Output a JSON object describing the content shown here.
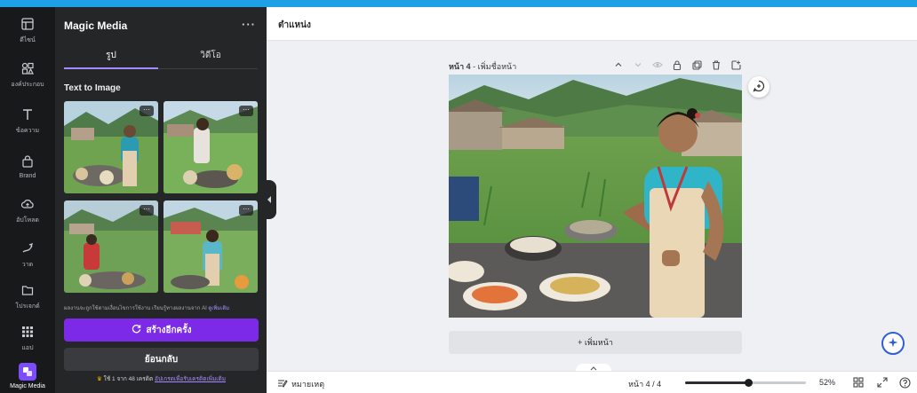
{
  "rail": {
    "items": [
      {
        "label": "ดีไซน์",
        "icon": "layout-icon"
      },
      {
        "label": "องค์ประกอบ",
        "icon": "elements-icon"
      },
      {
        "label": "ข้อความ",
        "icon": "text-icon"
      },
      {
        "label": "Brand",
        "icon": "brand-icon"
      },
      {
        "label": "อัปโหลด",
        "icon": "upload-icon"
      },
      {
        "label": "วาด",
        "icon": "draw-icon"
      },
      {
        "label": "โปรเจกต์",
        "icon": "folder-icon"
      },
      {
        "label": "แอป",
        "icon": "apps-icon"
      },
      {
        "label": "Magic Media",
        "icon": "magic-media-icon"
      }
    ]
  },
  "panel": {
    "title": "Magic Media",
    "more": "···",
    "tabs": [
      "รูป",
      "วิดีโอ"
    ],
    "section": "Text to Image",
    "thumb_more": "···",
    "disclaimer": "ผลงานจะถูกใช้ตามเงื่อนไขการใช้งาน เรียนรู้ทางผลงานจาก AI",
    "disclaimer_link": "ดูเพิ่มเติม",
    "generate_label": "สร้างอีกครั้ง",
    "back_label": "ย้อนกลับ",
    "usage_text": "ใช้ 1 จาก 48 เครดิต",
    "usage_link": "อัปเกรดเพื่อรับเครดิตเพิ่มเติม"
  },
  "topbar": {
    "position_label": "ตำแหน่ง"
  },
  "canvas": {
    "page_title_bold": "หน้า 4",
    "page_title_rest": " - เพิ่มชื่อหน้า",
    "add_page": "+ เพิ่มหน้า"
  },
  "bottombar": {
    "notes": "หมายเหตุ",
    "pager": "หน้า 4 / 4",
    "zoom_label": "52%",
    "zoom_value": 52
  },
  "colors": {
    "accent": "#7d2ae8",
    "rail": "#18191b",
    "panel": "#252627",
    "top_border": "#1ea0e6"
  }
}
